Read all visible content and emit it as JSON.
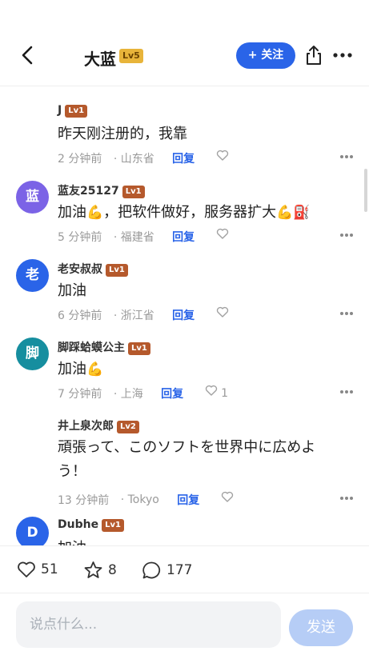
{
  "header": {
    "title": "大蓝",
    "level": "Lv5",
    "follow_label": "+ 关注"
  },
  "comments": [
    {
      "name": "J",
      "level": "Lv1",
      "text": "昨天刚注册的，我靠",
      "time": "2 分钟前",
      "location": "· 山东省",
      "reply": "回复",
      "likes": ""
    },
    {
      "name": "蓝友25127",
      "level": "Lv1",
      "avatar": "蓝",
      "avatar_color": "#7b63e6",
      "text": "加油",
      "text_emoji": "💪",
      "text_2": "，把软件做好，服务器扩大",
      "text_emoji_2": "💪⛽",
      "time": "5 分钟前",
      "location": "· 福建省",
      "reply": "回复",
      "likes": ""
    },
    {
      "name": "老安叔叔",
      "level": "Lv1",
      "avatar": "老",
      "avatar_color": "#2a64e8",
      "text": "加油",
      "time": "6 分钟前",
      "location": "· 浙江省",
      "reply": "回复",
      "likes": ""
    },
    {
      "name": "脚踩蛤蟆公主",
      "level": "Lv1",
      "avatar": "脚",
      "avatar_color": "#168e9f",
      "text": "加油",
      "text_emoji": "💪",
      "time": "7 分钟前",
      "location": "· 上海",
      "reply": "回复",
      "likes": "1"
    },
    {
      "name": "井上泉次郎",
      "level": "Lv2",
      "text": "頑張って、このソフトを世界中に広めよう！",
      "time": "13 分钟前",
      "location": "· Tokyo",
      "reply": "回复",
      "likes": ""
    },
    {
      "name": "Dubhe",
      "level": "Lv1",
      "avatar": "D",
      "avatar_color": "#2a64e8",
      "text": "加油"
    }
  ],
  "stats": {
    "likes": "51",
    "favorites": "8",
    "comments": "177"
  },
  "input": {
    "placeholder": "说点什么..."
  },
  "send_label": "发送",
  "colors": {
    "accent": "#2a64e8",
    "level_badge": "#b5592c",
    "level5_badge": "#e8b43a"
  },
  "icons": [
    "back-arrow-icon",
    "share-icon",
    "more-icon",
    "heart-icon",
    "star-icon",
    "comment-icon"
  ]
}
